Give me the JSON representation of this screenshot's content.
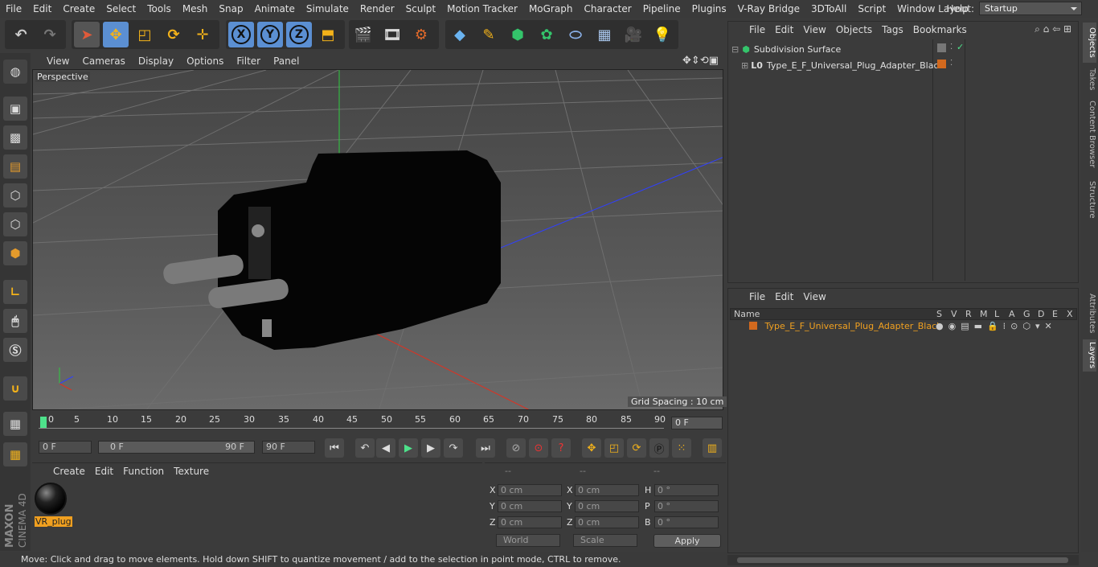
{
  "menubar": {
    "items": [
      "File",
      "Edit",
      "Create",
      "Select",
      "Tools",
      "Mesh",
      "Snap",
      "Animate",
      "Simulate",
      "Render",
      "Sculpt",
      "Motion Tracker",
      "MoGraph",
      "Character",
      "Pipeline",
      "Plugins",
      "V-Ray Bridge",
      "3DToAll",
      "Script",
      "Window",
      "Help"
    ]
  },
  "layout": {
    "label": "Layout:",
    "value": "Startup"
  },
  "toolbar": {
    "axis_x": "X",
    "axis_y": "Y",
    "axis_z": "Z"
  },
  "viewport": {
    "menu": [
      "View",
      "Cameras",
      "Display",
      "Options",
      "Filter",
      "Panel"
    ],
    "label": "Perspective",
    "grid_spacing": "Grid Spacing : 10 cm"
  },
  "timeline": {
    "ticks": [
      "0",
      "5",
      "10",
      "15",
      "20",
      "25",
      "30",
      "35",
      "40",
      "45",
      "50",
      "55",
      "60",
      "65",
      "70",
      "75",
      "80",
      "85",
      "90"
    ],
    "current_frame": "0 F"
  },
  "transport": {
    "start": "0 F",
    "range_start": "0 F",
    "range_end": "90 F",
    "end": "90 F"
  },
  "material": {
    "menu": [
      "Create",
      "Edit",
      "Function",
      "Texture"
    ],
    "name": "VR_plug"
  },
  "coords": {
    "headers": [
      "--",
      "--",
      "--"
    ],
    "rows": [
      {
        "l1": "X",
        "v1": "0 cm",
        "l2": "X",
        "v2": "0 cm",
        "l3": "H",
        "v3": "0 °"
      },
      {
        "l1": "Y",
        "v1": "0 cm",
        "l2": "Y",
        "v2": "0 cm",
        "l3": "P",
        "v3": "0 °"
      },
      {
        "l1": "Z",
        "v1": "0 cm",
        "l2": "Z",
        "v2": "0 cm",
        "l3": "B",
        "v3": "0 °"
      }
    ],
    "mode": "World",
    "size": "Scale",
    "apply": "Apply"
  },
  "status": "Move: Click and drag to move elements. Hold down SHIFT to quantize movement / add to the selection in point mode, CTRL to remove.",
  "objects": {
    "menu": [
      "File",
      "Edit",
      "View",
      "Objects",
      "Tags",
      "Bookmarks"
    ],
    "items": [
      "Subdivision Surface",
      "Type_E_F_Universal_Plug_Adapter_Black"
    ]
  },
  "layers": {
    "menu": [
      "File",
      "Edit",
      "View"
    ],
    "columns": [
      "Name",
      "S",
      "V",
      "R",
      "M",
      "L",
      "A",
      "G",
      "D",
      "E",
      "X"
    ],
    "row": "Type_E_F_Universal_Plug_Adapter_Black"
  },
  "side_tabs": [
    "Objects",
    "Takes",
    "Content Browser",
    "Structure",
    "Attributes",
    "Layers"
  ],
  "brand": {
    "maker": "MAXON",
    "product": "CINEMA 4D"
  },
  "colors": {
    "accent": "#5b8fd2",
    "material_highlight": "#f0a020",
    "layer_color": "#d2691e"
  }
}
